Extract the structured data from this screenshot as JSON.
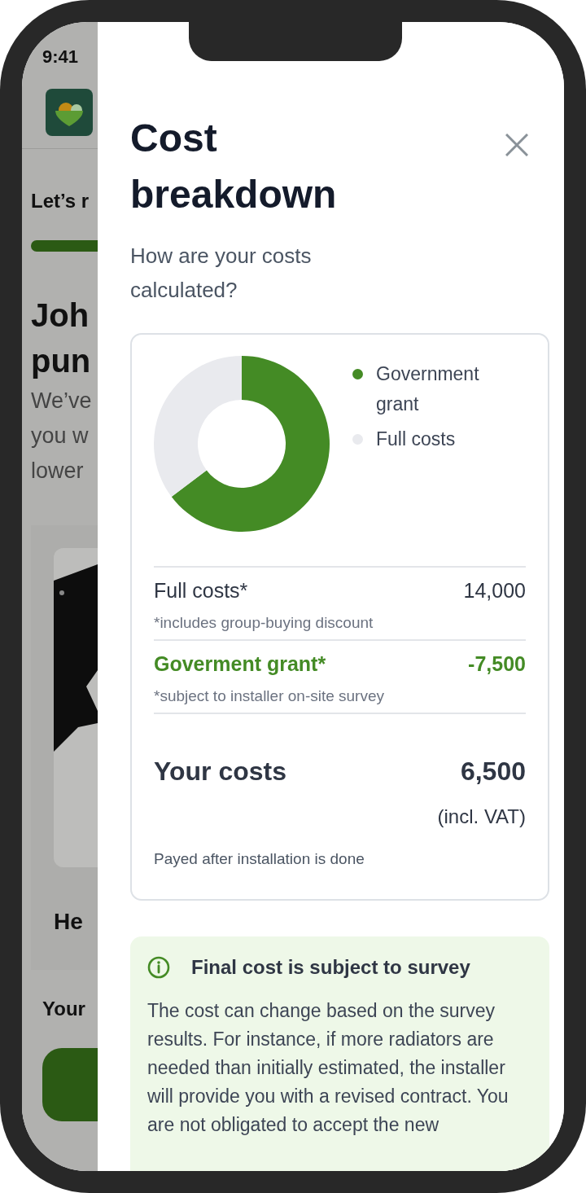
{
  "status_bar": {
    "time": "9:41"
  },
  "background_page": {
    "step_title": "Let’s r",
    "heading_lines": [
      "Joh",
      "pun"
    ],
    "body_lines": [
      "We’ve",
      "you w",
      "lower"
    ],
    "product_title": "He",
    "footer_label": "Your"
  },
  "dialog": {
    "title": "Cost breakdown",
    "subtitle": "How are your costs calculated?",
    "legend": [
      {
        "label": "Government grant",
        "color": "#448b25"
      },
      {
        "label": "Full costs",
        "color": "#e9eaee"
      }
    ],
    "rows": [
      {
        "kind": "normal",
        "label": "Full costs*",
        "value": "14,000",
        "note": "*includes group-buying discount"
      },
      {
        "kind": "highlight",
        "label": "Goverment grant*",
        "value": "-7,500",
        "note": "*subject to installer on-site survey"
      }
    ],
    "total": {
      "label": "Your costs",
      "value": "6,500",
      "vat": "(incl. VAT)",
      "note": "Payed after installation is done"
    },
    "notice": {
      "title": "Final cost is subject to survey",
      "body": "The cost can change based on the survey results. For instance, if more radiators are needed than initially estimated, the installer will provide you with a revised contract. You are not obligated to accept the new"
    }
  }
}
